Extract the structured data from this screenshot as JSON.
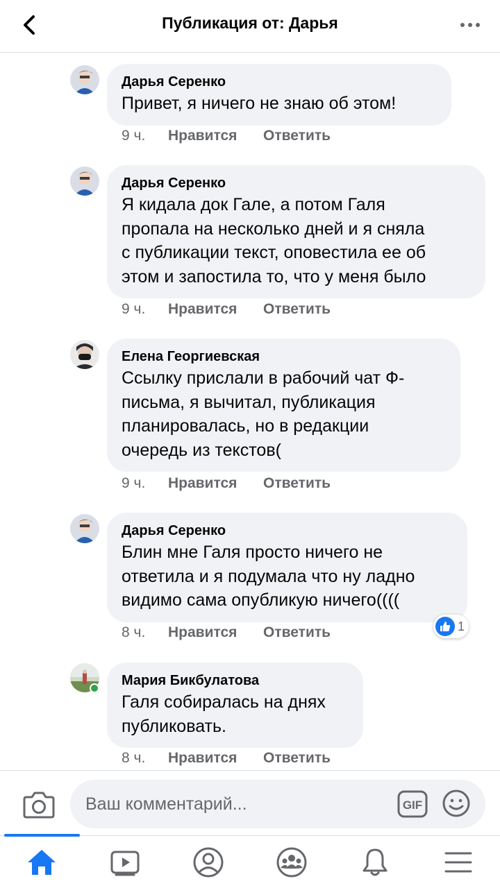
{
  "header": {
    "title": "Публикация от: Дарья",
    "back_icon": "chevron-left-icon",
    "more_icon": "more-dots-icon"
  },
  "comments": [
    {
      "author": "Дарья Серенко",
      "text": "Привет, я ничего не знаю об этом!",
      "time": "9 ч.",
      "like_label": "Нравится",
      "reply_label": "Ответить"
    },
    {
      "author": "Дарья Серенко",
      "lines": [
        "Я кидала док Гале, а потом Галя",
        "пропала на несколько дней и я сняла",
        "с публикации текст, оповестила ее об",
        "этом и запостила то, что у меня было"
      ],
      "time": "9 ч.",
      "like_label": "Нравится",
      "reply_label": "Ответить"
    },
    {
      "author": "Елена Георгиевская",
      "lines": [
        "Ссылку прислали в рабочий чат Ф-",
        "письма, я вычитал, публикация",
        "планировалась, но в редакции",
        "очередь из текстов("
      ],
      "time": "9 ч.",
      "like_label": "Нравится",
      "reply_label": "Ответить"
    },
    {
      "author": "Дарья Серенко",
      "lines": [
        "Блин мне Галя просто ничего не",
        "ответила и я подумала что ну ладно",
        "видимо сама опубликую ничего(((("
      ],
      "time": "8 ч.",
      "like_label": "Нравится",
      "reply_label": "Ответить",
      "reaction_count": "1"
    },
    {
      "author": "Мария Бикбулатова",
      "lines": [
        "Галя собиралась на днях",
        "публиковать."
      ],
      "time": "8 ч.",
      "like_label": "Нравится",
      "reply_label": "Ответить",
      "online": true
    }
  ],
  "composer": {
    "placeholder": "Ваш комментарий...",
    "camera_icon": "camera-icon",
    "gif_label": "GIF",
    "emoji_icon": "emoji-icon"
  },
  "bottom_nav": {
    "items": [
      "home-icon",
      "video-icon",
      "profile-icon",
      "groups-icon",
      "notifications-icon",
      "menu-icon"
    ],
    "active": "home-icon"
  },
  "colors": {
    "accent": "#1877f2",
    "bubble": "#f0f2f5",
    "secondary_text": "#65676b",
    "online": "#31a24c"
  }
}
